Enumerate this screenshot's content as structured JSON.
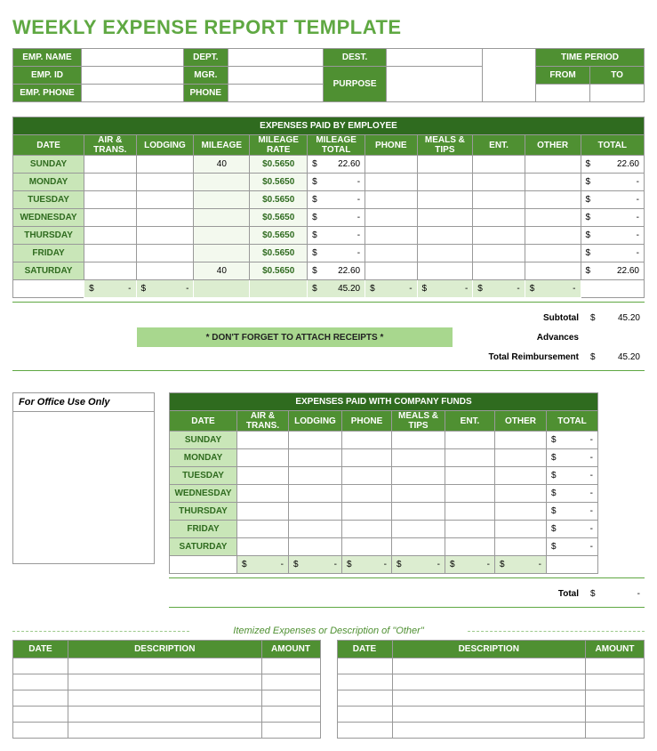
{
  "title": "WEEKLY EXPENSE REPORT TEMPLATE",
  "info": {
    "emp_name": "EMP. NAME",
    "dept": "DEPT.",
    "dest": "DEST.",
    "time_period": "TIME PERIOD",
    "emp_id": "EMP. ID",
    "mgr": "MGR.",
    "purpose": "PURPOSE",
    "from": "FROM",
    "to": "TO",
    "emp_phone": "EMP. PHONE",
    "phone": "PHONE"
  },
  "emp_table": {
    "title": "EXPENSES PAID BY EMPLOYEE",
    "cols": [
      "DATE",
      "AIR & TRANS.",
      "LODGING",
      "MILEAGE",
      "MILEAGE RATE",
      "MILEAGE TOTAL",
      "PHONE",
      "MEALS & TIPS",
      "ENT.",
      "OTHER",
      "TOTAL"
    ],
    "rows": [
      {
        "day": "SUNDAY",
        "mileage": "40",
        "rate": "$0.5650",
        "mtotal": "22.60",
        "total": "22.60"
      },
      {
        "day": "MONDAY",
        "mileage": "",
        "rate": "$0.5650",
        "mtotal": "-",
        "total": "-"
      },
      {
        "day": "TUESDAY",
        "mileage": "",
        "rate": "$0.5650",
        "mtotal": "-",
        "total": "-"
      },
      {
        "day": "WEDNESDAY",
        "mileage": "",
        "rate": "$0.5650",
        "mtotal": "-",
        "total": "-"
      },
      {
        "day": "THURSDAY",
        "mileage": "",
        "rate": "$0.5650",
        "mtotal": "-",
        "total": "-"
      },
      {
        "day": "FRIDAY",
        "mileage": "",
        "rate": "$0.5650",
        "mtotal": "-",
        "total": "-"
      },
      {
        "day": "SATURDAY",
        "mileage": "40",
        "rate": "$0.5650",
        "mtotal": "22.60",
        "total": "22.60"
      }
    ],
    "totals": {
      "air": "-",
      "lodging": "-",
      "mtotal": "45.20",
      "phone": "-",
      "meals": "-",
      "ent": "-",
      "other": "-"
    },
    "subtotal_lbl": "Subtotal",
    "subtotal": "45.20",
    "advances_lbl": "Advances",
    "advances": "",
    "reimb_lbl": "Total Reimbursement",
    "reimb": "45.20",
    "receipt": "* DON'T FORGET TO ATTACH RECEIPTS *"
  },
  "office_use": "For Office Use Only",
  "comp_table": {
    "title": "EXPENSES PAID WITH COMPANY FUNDS",
    "cols": [
      "DATE",
      "AIR & TRANS.",
      "LODGING",
      "PHONE",
      "MEALS & TIPS",
      "ENT.",
      "OTHER",
      "TOTAL"
    ],
    "days": [
      "SUNDAY",
      "MONDAY",
      "TUESDAY",
      "WEDNESDAY",
      "THURSDAY",
      "FRIDAY",
      "SATURDAY"
    ],
    "row_total": "-",
    "totals": [
      "-",
      "-",
      "-",
      "-",
      "-",
      "-"
    ],
    "total_lbl": "Total",
    "total": "-"
  },
  "itemized_lbl": "Itemized Expenses or Description of \"Other\"",
  "itembox_cols": [
    "DATE",
    "DESCRIPTION",
    "AMOUNT"
  ]
}
